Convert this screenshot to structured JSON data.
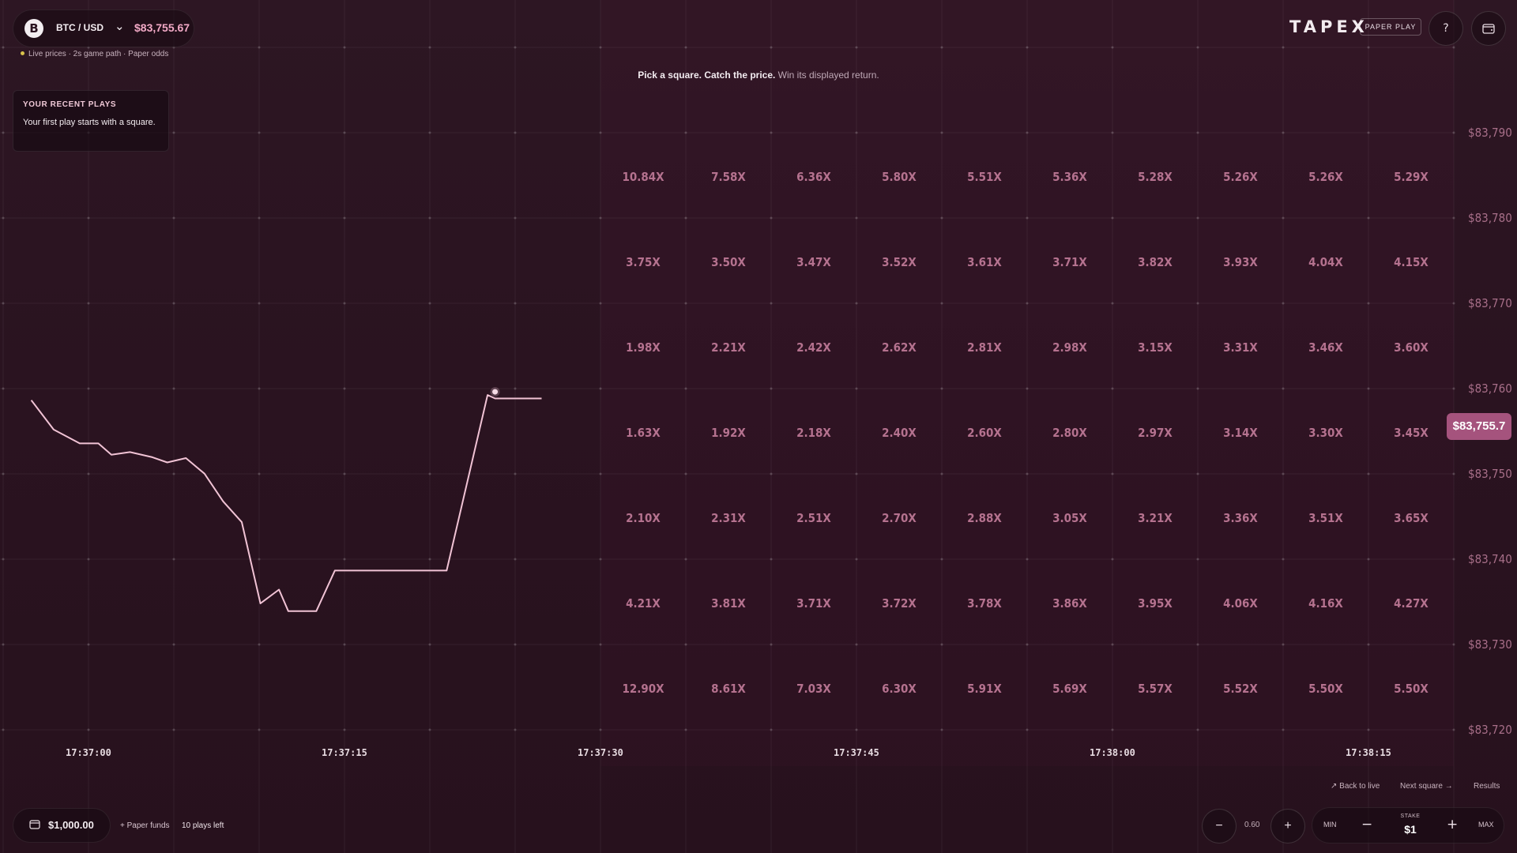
{
  "header": {
    "pair": "BTC / USD",
    "coin_symbol": "B",
    "price": "$83,755.67",
    "status": "Live prices · 2s game path · Paper odds",
    "brand": "TAPEX",
    "mode_badge": "PAPER PLAY",
    "help_icon": "question-icon",
    "wallet_icon": "wallet-icon"
  },
  "recent": {
    "title": "YOUR RECENT PLAYS",
    "text": "Your first play starts with a square."
  },
  "tagline": {
    "bold": "Pick a square. Catch the price.",
    "rest": " Win its displayed return."
  },
  "current_price_tag": "$83,755.7",
  "price_axis": [
    "$83,790",
    "$83,780",
    "$83,770",
    "$83,760",
    "$83,750",
    "$83,740",
    "$83,730",
    "$83,720"
  ],
  "time_axis": [
    "17:37:00",
    "17:37:15",
    "17:37:30",
    "17:37:45",
    "17:38:00",
    "17:38:15"
  ],
  "multipliers": [
    [
      "10.84X",
      "7.58X",
      "6.36X",
      "5.80X",
      "5.51X",
      "5.36X",
      "5.28X",
      "5.26X",
      "5.26X",
      "5.29X"
    ],
    [
      "3.75X",
      "3.50X",
      "3.47X",
      "3.52X",
      "3.61X",
      "3.71X",
      "3.82X",
      "3.93X",
      "4.04X",
      "4.15X"
    ],
    [
      "1.98X",
      "2.21X",
      "2.42X",
      "2.62X",
      "2.81X",
      "2.98X",
      "3.15X",
      "3.31X",
      "3.46X",
      "3.60X"
    ],
    [
      "1.63X",
      "1.92X",
      "2.18X",
      "2.40X",
      "2.60X",
      "2.80X",
      "2.97X",
      "3.14X",
      "3.30X",
      "3.45X"
    ],
    [
      "2.10X",
      "2.31X",
      "2.51X",
      "2.70X",
      "2.88X",
      "3.05X",
      "3.21X",
      "3.36X",
      "3.51X",
      "3.65X"
    ],
    [
      "4.21X",
      "3.81X",
      "3.71X",
      "3.72X",
      "3.78X",
      "3.86X",
      "3.95X",
      "4.06X",
      "4.16X",
      "4.27X"
    ],
    [
      "12.90X",
      "8.61X",
      "7.03X",
      "6.30X",
      "5.91X",
      "5.69X",
      "5.57X",
      "5.52X",
      "5.50X",
      "5.50X"
    ]
  ],
  "chart_data": {
    "type": "line",
    "x": [
      -0.1,
      1.1,
      2.5,
      3.5,
      4.2,
      5.2,
      6.4,
      7.2,
      8.2,
      9.2,
      10.2,
      11.2,
      12.2,
      13.2,
      13.7,
      15.2,
      16.2,
      17.2,
      18.2,
      19.2,
      20.2,
      21.2,
      22.2,
      24.4,
      24.8,
      25.5,
      26.1,
      26.9,
      27.3
    ],
    "y": [
      83754.7,
      83751.3,
      83749.7,
      83749.7,
      83748.4,
      83748.7,
      83748.1,
      83747.5,
      83748.0,
      83746.2,
      83743.0,
      83740.6,
      83731.2,
      83732.8,
      83730.3,
      83730.3,
      83735.0,
      83735.0,
      83735.0,
      83735.0,
      83735.0,
      83735.0,
      83735.0,
      83755.3,
      83754.9,
      83754.9,
      83754.9,
      83754.9,
      83754.9
    ],
    "x_unit": "seconds after 17:37:00",
    "xlim": [
      -1.78,
      76.19
    ],
    "ylim": [
      83716.4,
      83795.5
    ],
    "current": {
      "x": 24.8,
      "y": 83755.67
    }
  },
  "footer": {
    "back_to_live": "Back to live",
    "next_square": "Next square →",
    "results": "Results",
    "balance": "$1,000.00",
    "paper_funds": "+ Paper funds",
    "plays_left": "10 plays left",
    "multiplier_value": "0.60",
    "stake_min": "MIN",
    "stake_label": "STAKE",
    "stake_value": "$1",
    "stake_max": "MAX"
  },
  "colors": {
    "accent": "#a5537d",
    "line": "#f1c3d5",
    "price": "#f2a9c6"
  }
}
